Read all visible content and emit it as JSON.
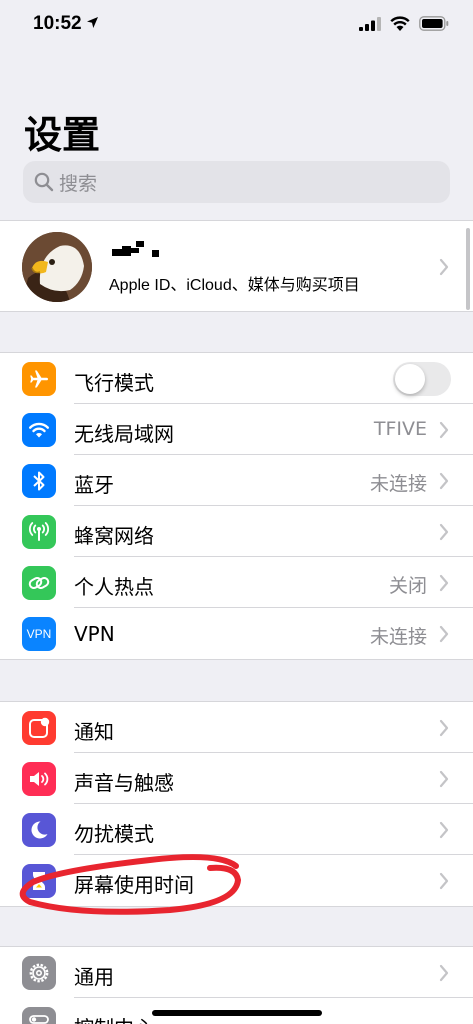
{
  "status_bar": {
    "time": "10:52"
  },
  "title": "设置",
  "search": {
    "placeholder": "搜索"
  },
  "profile": {
    "subtitle": "Apple ID、iCloud、媒体与购买项目"
  },
  "group1": [
    {
      "label": "飞行模式",
      "icon": "airplane-icon",
      "color": "#ff9500",
      "toggle": false
    },
    {
      "label": "无线局域网",
      "value": "TFIVE",
      "icon": "wifi-icon",
      "color": "#007aff"
    },
    {
      "label": "蓝牙",
      "value": "未连接",
      "icon": "bluetooth-icon",
      "color": "#007aff"
    },
    {
      "label": "蜂窝网络",
      "icon": "cellular-icon",
      "color": "#34c759"
    },
    {
      "label": "个人热点",
      "value": "关闭",
      "icon": "hotspot-icon",
      "color": "#34c759"
    },
    {
      "label": "VPN",
      "value": "未连接",
      "icon": "vpn-icon",
      "icon_text": "VPN",
      "color": "#0a84ff"
    }
  ],
  "group2": [
    {
      "label": "通知",
      "icon": "notifications-icon",
      "color": "#ff3b30"
    },
    {
      "label": "声音与触感",
      "icon": "sound-icon",
      "color": "#ff2d55"
    },
    {
      "label": "勿扰模式",
      "icon": "moon-icon",
      "color": "#5856d6"
    },
    {
      "label": "屏幕使用时间",
      "icon": "hourglass-icon",
      "color": "#5856d6"
    }
  ],
  "group3": [
    {
      "label": "通用",
      "icon": "gear-icon",
      "color": "#8e8e93"
    },
    {
      "label": "控制中心",
      "icon": "control-center-icon",
      "color": "#8e8e93"
    }
  ],
  "annotation_color": "#e8252f"
}
